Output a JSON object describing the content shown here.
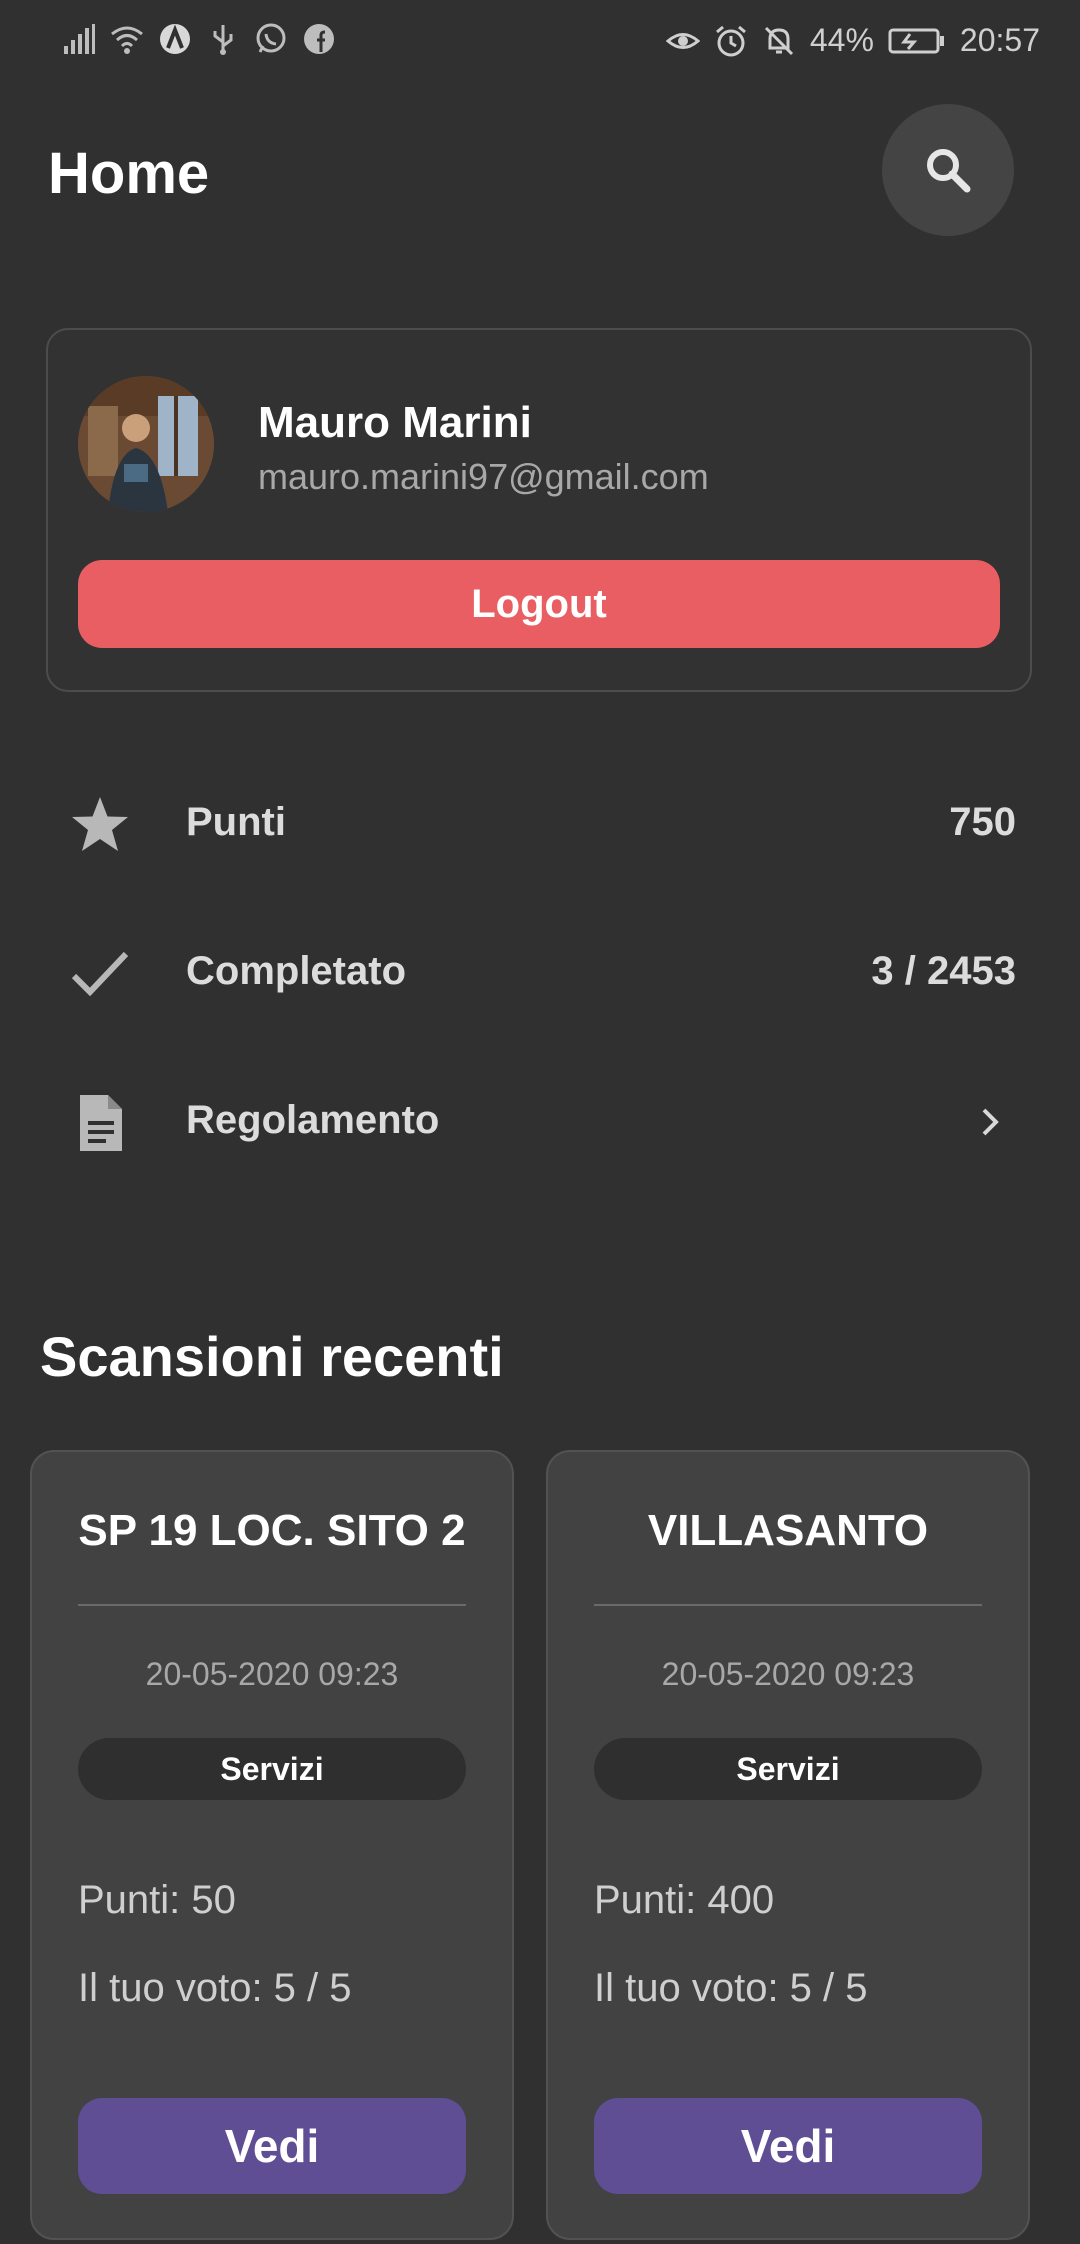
{
  "status_bar": {
    "battery": "44%",
    "time": "20:57",
    "left_icons": [
      "signal-icon",
      "wifi-icon",
      "app-a-icon",
      "usb-icon",
      "whatsapp-icon",
      "facebook-icon"
    ],
    "right_icons": [
      "eye-icon",
      "alarm-icon",
      "notifications-off-icon",
      "battery-icon"
    ]
  },
  "header": {
    "title": "Home",
    "search_icon": "search-icon"
  },
  "profile": {
    "name": "Mauro Marini",
    "email": "mauro.marini97@gmail.com",
    "logout_label": "Logout"
  },
  "stats": [
    {
      "icon": "star-icon",
      "label": "Punti",
      "value": "750"
    },
    {
      "icon": "check-icon",
      "label": "Completato",
      "value": "3 / 2453"
    },
    {
      "icon": "document-icon",
      "label": "Regolamento",
      "value": ""
    }
  ],
  "recent": {
    "title": "Scansioni recenti",
    "items": [
      {
        "title": "SP 19 LOC. SITO 2",
        "date": "20-05-2020 09:23",
        "category": "Servizi",
        "points": "Punti: 50",
        "vote": "Il tuo voto: 5 / 5",
        "button": "Vedi"
      },
      {
        "title": "VILLASANTO",
        "date": "20-05-2020 09:23",
        "category": "Servizi",
        "points": "Punti: 400",
        "vote": "Il tuo voto: 5 / 5",
        "button": "Vedi"
      }
    ]
  },
  "colors": {
    "background": "#303030",
    "logout": "#e85e63",
    "view_button": "#5f4e94",
    "card": "#424242"
  }
}
